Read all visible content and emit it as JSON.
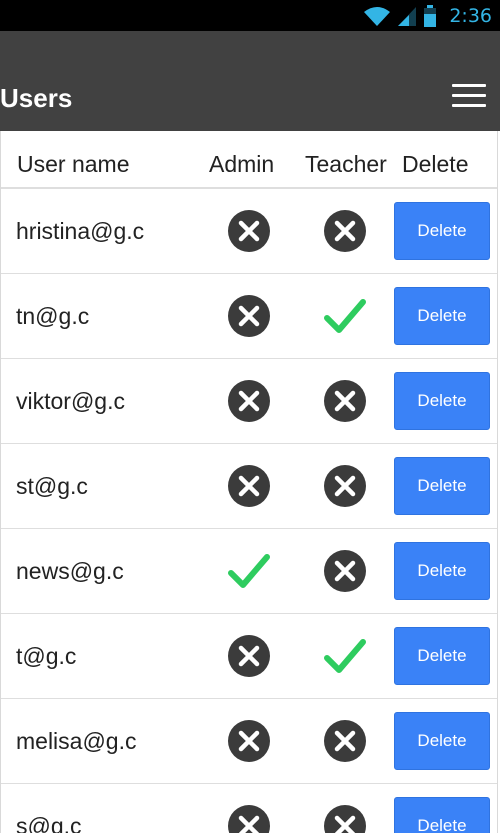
{
  "status_bar": {
    "time": "2:36"
  },
  "app_bar": {
    "title": "Users"
  },
  "table": {
    "columns": [
      "User name",
      "Admin",
      "Teacher",
      "Delete"
    ],
    "rows": [
      {
        "user": "hristina@g.c",
        "admin": false,
        "teacher": false,
        "delete_label": "Delete"
      },
      {
        "user": "tn@g.c",
        "admin": false,
        "teacher": true,
        "delete_label": "Delete"
      },
      {
        "user": "viktor@g.c",
        "admin": false,
        "teacher": false,
        "delete_label": "Delete"
      },
      {
        "user": "st@g.c",
        "admin": false,
        "teacher": false,
        "delete_label": "Delete"
      },
      {
        "user": "news@g.c",
        "admin": true,
        "teacher": false,
        "delete_label": "Delete"
      },
      {
        "user": "t@g.c",
        "admin": false,
        "teacher": true,
        "delete_label": "Delete"
      },
      {
        "user": "melisa@g.c",
        "admin": false,
        "teacher": false,
        "delete_label": "Delete"
      },
      {
        "user": "s@g.c",
        "admin": false,
        "teacher": false,
        "delete_label": "Delete"
      }
    ]
  },
  "colors": {
    "status_icon": "#33b5e5",
    "app_bar": "#414141",
    "delete_button": "#3a82f7",
    "check": "#2ecc5f",
    "cross_circle": "#3b3b3b"
  },
  "icons": {
    "true_icon": "checkmark-icon",
    "false_icon": "x-circle-icon"
  }
}
